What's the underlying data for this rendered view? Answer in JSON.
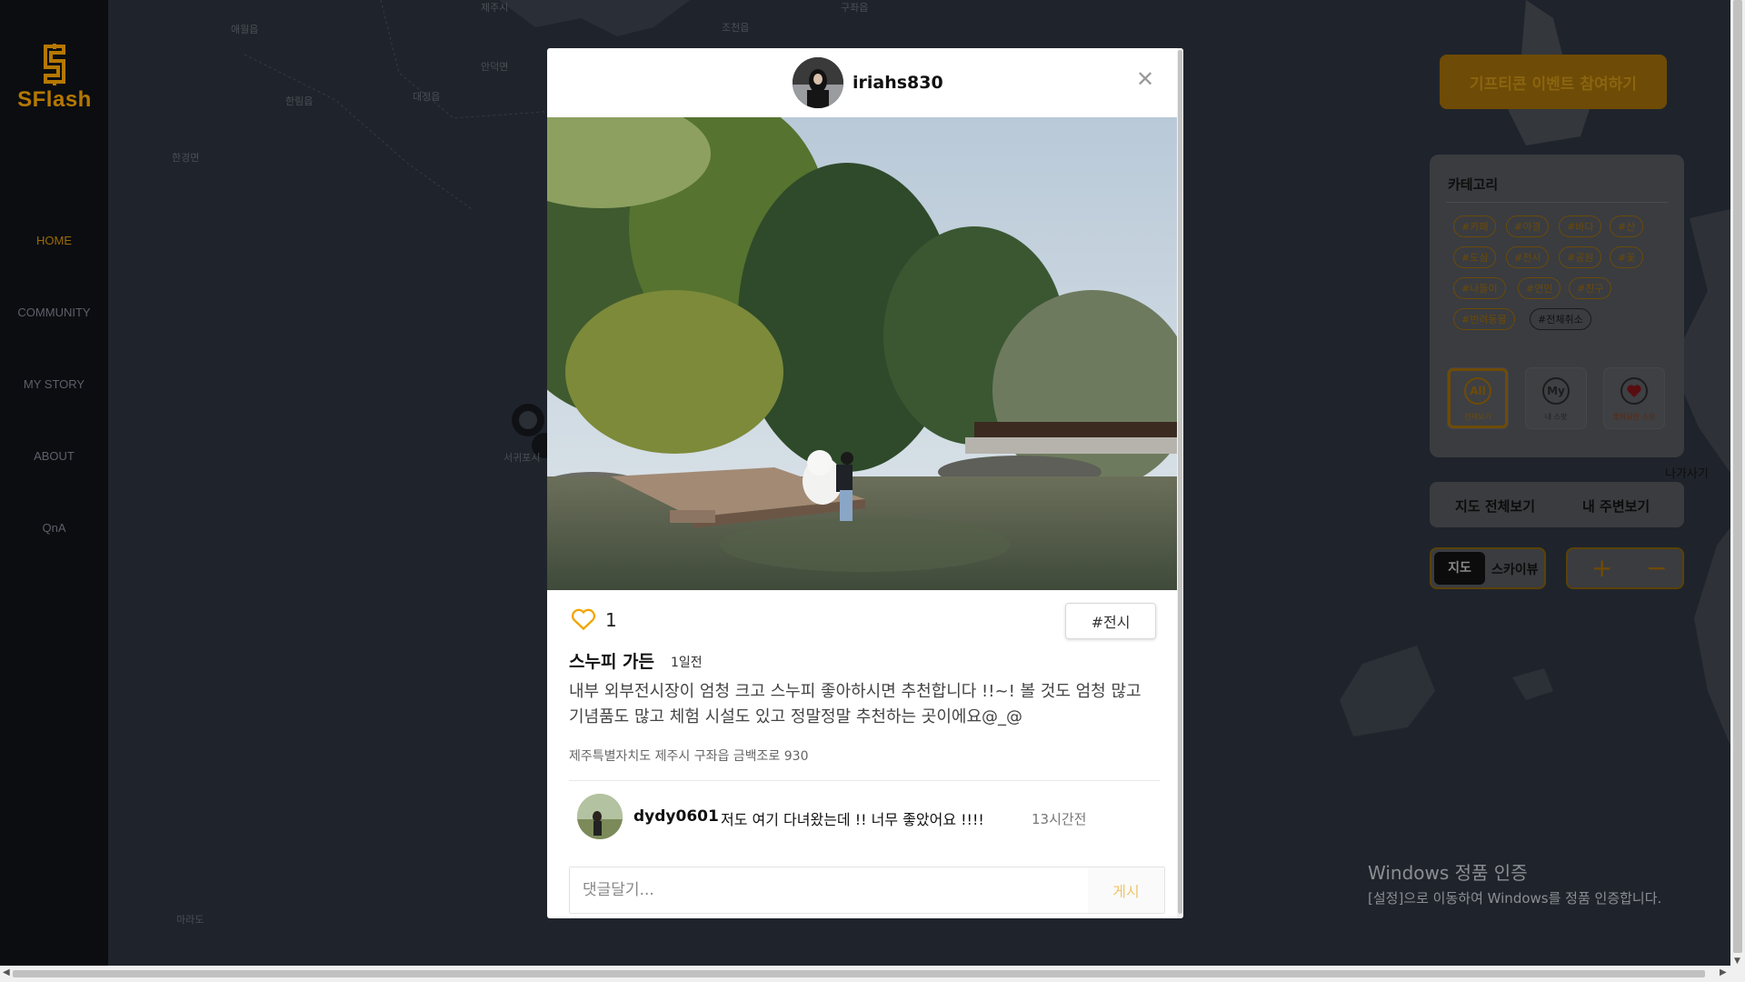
{
  "app": {
    "logo_text": "SFlash"
  },
  "nav": [
    {
      "label": "HOME",
      "active": true
    },
    {
      "label": "COMMUNITY"
    },
    {
      "label": "MY STORY"
    },
    {
      "label": "ABOUT"
    },
    {
      "label": "QnA"
    }
  ],
  "map": {
    "labels": [
      "애월읍",
      "한림읍",
      "제주시",
      "조천읍",
      "구좌읍",
      "한경면",
      "대정읍",
      "안덕면",
      "서귀포시",
      "마라도"
    ]
  },
  "right_panel": {
    "event_button": "기프티콘 이벤트 참여하기",
    "category_title": "카테고리",
    "tags": [
      "#카페",
      "#야경",
      "#바다",
      "#산",
      "#도심",
      "#전시",
      "#공원",
      "#꽃",
      "#나들이",
      "#연인",
      "#친구",
      "#반려동물",
      "#전체취소"
    ],
    "filters": [
      {
        "icon": "All",
        "label": "전체보기"
      },
      {
        "icon": "My",
        "label": "내 스팟"
      },
      {
        "icon": "heart",
        "label": "좋아요한 스팟"
      }
    ],
    "exit_label": "나가사기",
    "view_all": "지도 전체보기",
    "nearby": "내 주변보기",
    "map_mode": "지도",
    "sky_mode": "스카이뷰",
    "zoom_in": "+",
    "zoom_out": "−"
  },
  "watermark": {
    "line1": "Windows 정품 인증",
    "line2": "[설정]으로 이동하여 Windows를 정품 인증합니다."
  },
  "post": {
    "username": "iriahs830",
    "likes": "1",
    "tag": "#전시",
    "place": "스누피 가든",
    "time": "1일전",
    "body": "내부 외부전시장이 엄청 크고 스누피 좋아하시면 추천합니다 !!~! 볼 것도 엄청 많고 기념품도 많고 체험 시설도 있고 정말정말 추천하는 곳이에요@_@",
    "address": "제주특별자치도 제주시 구좌읍 금백조로 930",
    "comments": [
      {
        "user": "dydy0601",
        "text": "저도 여기 다녀왔는데 !! 너무 좋았어요 !!!!",
        "time": "13시간전"
      }
    ],
    "comment_placeholder": "댓글달기...",
    "submit_label": "게시"
  },
  "colors": {
    "accent": "#f0a500",
    "accent_dim": "#6e4b06",
    "overlay": "#1e232b"
  }
}
